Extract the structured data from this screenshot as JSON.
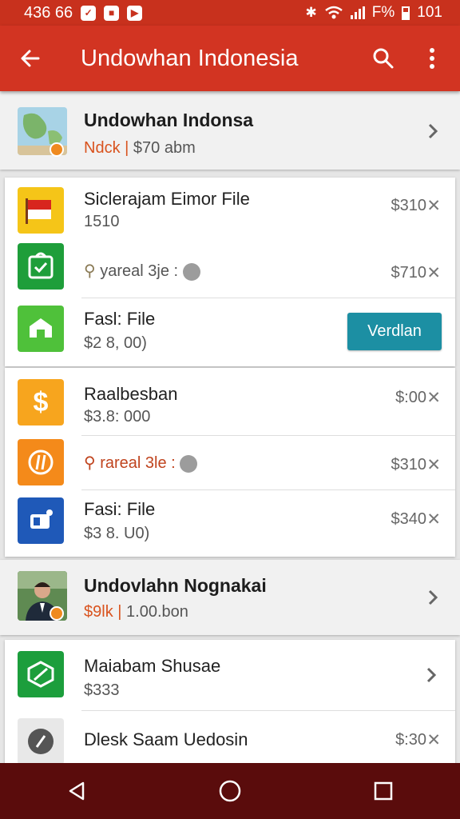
{
  "status_bar": {
    "time": "436 66",
    "battery_text": "F%",
    "right_time": "101",
    "notification_icons": [
      "shield-notification-icon",
      "square-notification-icon",
      "youtube-notification-icon"
    ]
  },
  "app_bar": {
    "title": "Undowhan Indonesia",
    "icons": [
      "back-arrow-icon",
      "search-icon",
      "more-vert-icon"
    ]
  },
  "header_item": {
    "title": "Undowhan Indonsa",
    "sub_accent": "Ndck",
    "sub_rest": "$70 abm"
  },
  "card1": {
    "items": [
      {
        "title": "Siclerajam Eimor File",
        "sub": "1510",
        "price": "$310",
        "icon": "flag-icon",
        "icon_color": "#f5c518"
      },
      {
        "title": "yareal 3je",
        "price": "$710",
        "icon": "bag-check-icon",
        "icon_color": "#1e9e3a"
      },
      {
        "title": "Fasl: File",
        "sub": "$2 8, 00)",
        "button": "Verdlan",
        "icon": "house-icon",
        "icon_color": "#4fc13a"
      }
    ]
  },
  "card2": {
    "items": [
      {
        "title": "Raalbesban",
        "sub": "$3.8: 000",
        "price": "$:00",
        "icon": "dollar-icon",
        "icon_color": "#f7a51e"
      },
      {
        "title": "rareal 3le",
        "price": "$310",
        "icon": "circle-slash-icon",
        "icon_color": "#f48a1a"
      },
      {
        "title": "Fasi: File",
        "sub": "$3 8. U0)",
        "price": "$340",
        "icon": "screen-icon",
        "icon_color": "#1f59b8"
      }
    ]
  },
  "profile_item": {
    "title": "Undovlahn Nognakai",
    "sub_accent": "$9lk",
    "sub_rest": "1.00.bon"
  },
  "card3": {
    "items": [
      {
        "title": "Maiabam Shusae",
        "sub": "$333",
        "icon": "leaf-icon",
        "icon_color": "#1c9e3c"
      },
      {
        "title": "Dlesk Saam Uedosin",
        "price": "$:30",
        "icon": "dial-icon",
        "icon_color": "#555555"
      }
    ]
  },
  "colors": {
    "status_bar": "#c8311d",
    "app_bar": "#d23422",
    "nav_bar": "#5a0c0c",
    "accent": "#d9531e",
    "button": "#1c8fa3"
  }
}
